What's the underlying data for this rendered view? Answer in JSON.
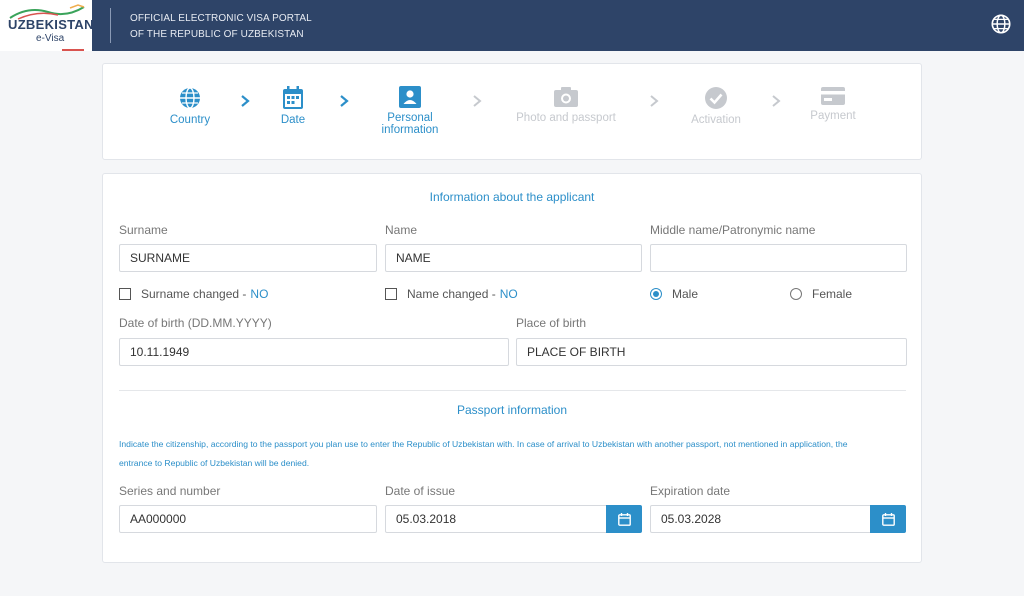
{
  "header": {
    "logo_text": "UZBEKISTAN",
    "logo_sub": "e-Visa",
    "portal_line1": "OFFICIAL ELECTRONIC VISA PORTAL",
    "portal_line2": "OF THE REPUBLIC OF UZBEKISTAN",
    "language_icon": "globe-icon"
  },
  "steps": [
    {
      "label": "Country",
      "icon": "globe-icon",
      "state": "done"
    },
    {
      "label": "Date",
      "icon": "calendar-icon",
      "state": "done"
    },
    {
      "label_line1": "Personal",
      "label_line2": "information",
      "icon": "id-card-icon",
      "state": "current"
    },
    {
      "label": "Photo and passport",
      "icon": "camera-icon",
      "state": "pending"
    },
    {
      "label": "Activation",
      "icon": "check-circle-icon",
      "state": "pending"
    },
    {
      "label": "Payment",
      "icon": "credit-card-icon",
      "state": "pending"
    }
  ],
  "applicant": {
    "section_title": "Information about the applicant",
    "surname_label": "Surname",
    "surname_value": "SURNAME",
    "name_label": "Name",
    "name_value": "NAME",
    "middle_label": "Middle name/Patronymic name",
    "middle_value": "",
    "surname_changed_label": "Surname changed -",
    "surname_changed_value": "NO",
    "name_changed_label": "Name changed -",
    "name_changed_value": "NO",
    "gender_male": "Male",
    "gender_female": "Female",
    "gender_selected": "Male",
    "dob_label": "Date of birth (DD.MM.YYYY)",
    "dob_value": "10.11.1949",
    "pob_label": "Place of birth",
    "pob_value": "PLACE OF BIRTH"
  },
  "passport": {
    "section_title": "Passport information",
    "notice_line1": "Indicate the citizenship, according to the passport you plan use to enter the Republic of Uzbekistan with. In case of arrival to Uzbekistan with another passport, not mentioned in application, the",
    "notice_line2": "entrance to Republic of Uzbekistan will be denied.",
    "series_label": "Series and number",
    "series_value": "AA000000",
    "issue_label": "Date of issue",
    "issue_value": "05.03.2018",
    "expiry_label": "Expiration date",
    "expiry_value": "05.03.2028"
  },
  "colors": {
    "header_bg": "#2e4468",
    "accent": "#2c8fc9",
    "inactive": "#c6c9ce"
  }
}
